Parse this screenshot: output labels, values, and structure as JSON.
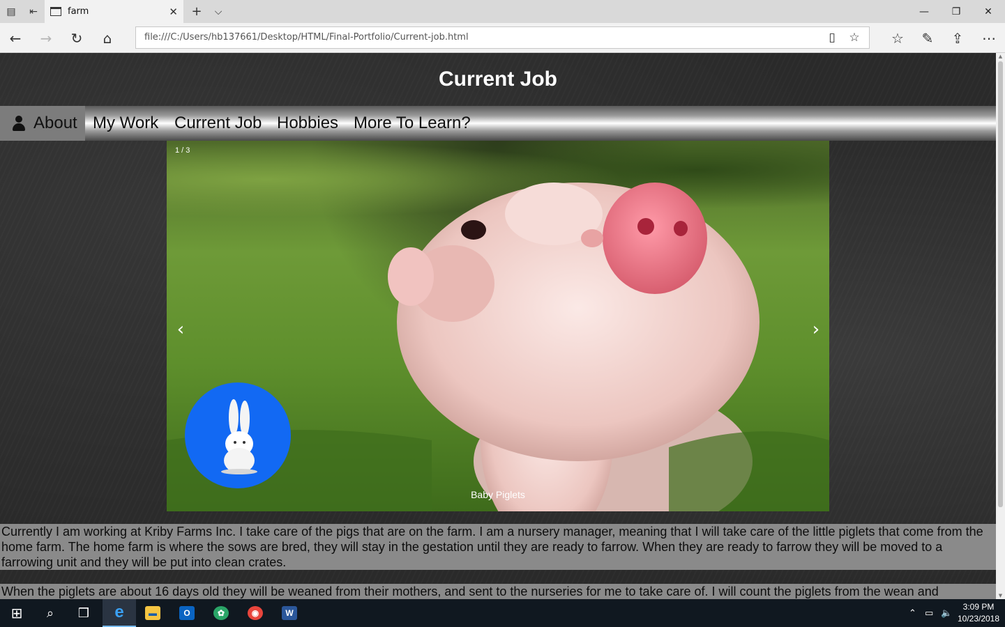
{
  "browser": {
    "tab_title": "farm",
    "tab_close": "✕",
    "new_tab": "+",
    "tab_list": "⌵",
    "address": "file:///C:/Users/hb137661/Desktop/HTML/Final-Portfolio/Current-job.html",
    "icons": {
      "tab_manager": "tab-manager-icon",
      "set_aside": "set-aside-tabs-icon",
      "back": "back-arrow-icon",
      "forward": "forward-arrow-icon",
      "refresh": "refresh-icon",
      "home": "home-icon",
      "reading_view": "reading-view-icon",
      "favorite": "star-icon",
      "favorites_hub": "favorites-hub-icon",
      "notes": "pen-icon",
      "share": "share-icon",
      "more": "more-dots-icon"
    },
    "glyphs": {
      "back": "←",
      "forward": "→",
      "refresh": "↻",
      "home": "⌂",
      "reading_view": "▯",
      "favorite": "☆",
      "favorites_hub": "☆",
      "notes": "✎",
      "share": "⇪",
      "more": "⋯",
      "minimize": "—",
      "maximize": "❐",
      "close": "✕",
      "tab_manager": "▤",
      "set_aside": "⇤"
    }
  },
  "page": {
    "title": "Current Job",
    "nav": [
      {
        "label": "About",
        "active": true
      },
      {
        "label": "My Work"
      },
      {
        "label": "Current Job"
      },
      {
        "label": "Hobbies"
      },
      {
        "label": "More To Learn?"
      }
    ],
    "slideshow": {
      "counter": "1 / 3",
      "caption": "Baby Piglets",
      "prev": "‹",
      "next": "›"
    },
    "paragraphs": [
      "Currently I am working at Kriby Farms Inc. I take care of the pigs that are on the farm. I am a nursery manager, meaning that I will take care of the little piglets that come from the home farm. The home farm is where the sows are bred, they will stay in the gestation until they are ready to farrow. When they are ready to farrow they will be moved to a farrowing unit and they will be put into clean crates.",
      "When the piglets are about 16 days old they will be weaned from their mothers, and sent to the nurseries for me to take care of. I will count the piglets from the wean and"
    ]
  },
  "taskbar": {
    "start_glyph": "⊞",
    "search_glyph": "⌕",
    "task_view_glyph": "❒",
    "apps": [
      {
        "name": "edge",
        "label": "e",
        "color": "#1e88e5"
      },
      {
        "name": "file-explorer",
        "label": "▬",
        "color": "#f5c542"
      },
      {
        "name": "outlook",
        "label": "O",
        "color": "#0a64c2"
      },
      {
        "name": "app-green",
        "label": "✿",
        "color": "#2aa567"
      },
      {
        "name": "chrome",
        "label": "◉",
        "color": "#e8453c"
      },
      {
        "name": "word",
        "label": "W",
        "color": "#2b579a"
      }
    ],
    "tray_glyphs": {
      "chevron": "⌃",
      "network": "▭",
      "volume": "🔈"
    },
    "time": "3:09 PM",
    "date": "10/23/2018"
  }
}
